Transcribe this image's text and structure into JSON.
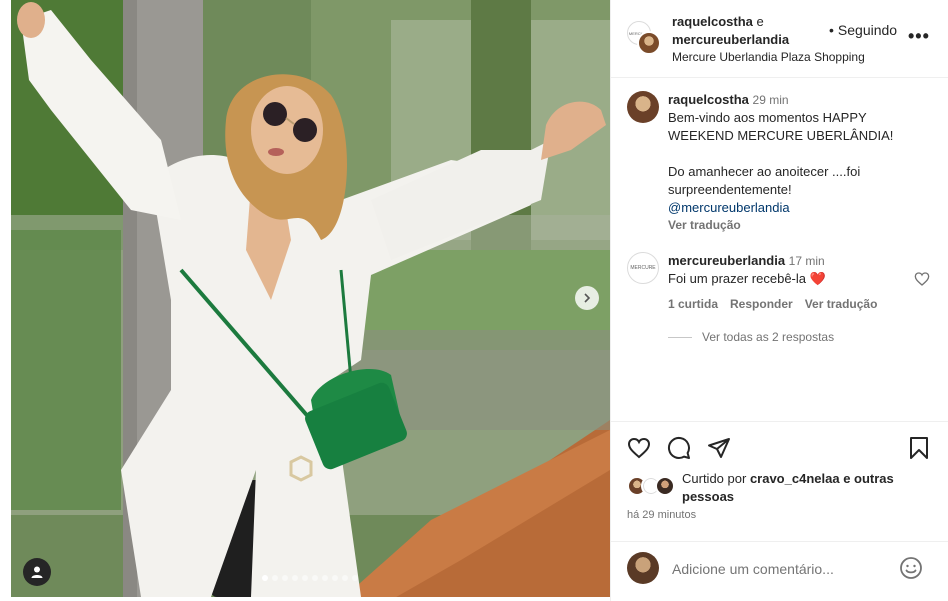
{
  "post": {
    "slide_count": 10,
    "active_slide": 1
  },
  "header": {
    "user1": "raquelcostha",
    "joiner": "e",
    "user2": "mercureuberlandia",
    "follow_status": "Seguindo",
    "location": "Mercure Uberlandia Plaza Shopping",
    "mercure_avatar_text": "MERCURE"
  },
  "caption": {
    "username": "raquelcostha",
    "time": "29 min",
    "text1": "Bem-vindo aos momentos HAPPY WEEKEND MERCURE UBERLÂNDIA!",
    "text2": "Do amanhecer ao anoitecer ....foi surpreendentemente!",
    "mention": "@mercureuberlandia",
    "translate": "Ver tradução"
  },
  "comment": {
    "username": "mercureuberlandia",
    "time": "17 min",
    "text": "Foi um prazer recebê-la",
    "emoji": "❤️",
    "likes": "1 curtida",
    "reply": "Responder",
    "translate": "Ver tradução",
    "view_replies": "Ver todas as 2 respostas"
  },
  "likes": {
    "prefix": "Curtido por",
    "user": "cravo_c4nelaa",
    "suffix": "e outras pessoas"
  },
  "timestamp": "há 29 minutos",
  "add_comment": {
    "placeholder": "Adicione um comentário..."
  },
  "icons": {
    "like": "heart-icon",
    "comment": "comment-icon",
    "share": "share-icon",
    "save": "bookmark-icon",
    "emoji": "emoji-icon",
    "more": "more-options-icon",
    "next": "chevron-right-icon",
    "user_tag": "user-tag-icon"
  }
}
